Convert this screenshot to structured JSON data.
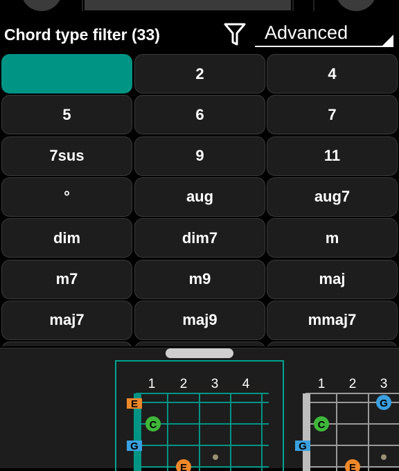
{
  "header": {
    "title": "Chord type filter (33)",
    "mode_value": "Advanced"
  },
  "chord_types": [
    {
      "label": "",
      "selected": true
    },
    {
      "label": "2",
      "selected": false
    },
    {
      "label": "4",
      "selected": false
    },
    {
      "label": "5",
      "selected": false
    },
    {
      "label": "6",
      "selected": false
    },
    {
      "label": "7",
      "selected": false
    },
    {
      "label": "7sus",
      "selected": false
    },
    {
      "label": "9",
      "selected": false
    },
    {
      "label": "11",
      "selected": false
    },
    {
      "label": "°",
      "selected": false
    },
    {
      "label": "aug",
      "selected": false
    },
    {
      "label": "aug7",
      "selected": false
    },
    {
      "label": "dim",
      "selected": false
    },
    {
      "label": "dim7",
      "selected": false
    },
    {
      "label": "m",
      "selected": false
    },
    {
      "label": "m7",
      "selected": false
    },
    {
      "label": "m9",
      "selected": false
    },
    {
      "label": "maj",
      "selected": false
    },
    {
      "label": "maj7",
      "selected": false
    },
    {
      "label": "maj9",
      "selected": false
    },
    {
      "label": "mmaj7",
      "selected": false
    }
  ],
  "diagrams": [
    {
      "fret_numbers": [
        "1",
        "2",
        "3",
        "4"
      ],
      "notes": [
        {
          "label": "E",
          "color": "#f0882a"
        },
        {
          "label": "C",
          "color": "#3fb83a"
        },
        {
          "label": "G",
          "color": "#3aa0e0"
        },
        {
          "label": "E",
          "color": "#f0882a"
        }
      ],
      "selected": true
    },
    {
      "fret_numbers": [
        "1",
        "2",
        "3"
      ],
      "notes": [
        {
          "label": "G",
          "color": "#3aa0e0"
        },
        {
          "label": "C",
          "color": "#3fb83a"
        },
        {
          "label": "G",
          "color": "#3aa0e0"
        },
        {
          "label": "E",
          "color": "#f0882a"
        }
      ],
      "selected": false
    }
  ],
  "colors": {
    "accent": "#009485",
    "button_bg": "#1d1d1d",
    "button_border": "#3a3a3a"
  }
}
